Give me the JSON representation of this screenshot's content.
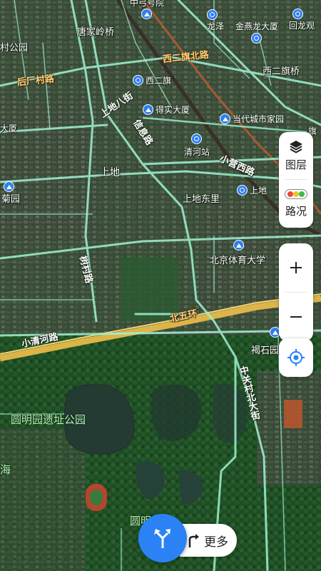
{
  "map": {
    "roads": {
      "xi_er_qi_north": "西二旗北路",
      "hou_chang_cun": "后厂村路",
      "shangdi_8th": "上地八街",
      "xinxi": "信息路",
      "xiaoying_west": "小营西路",
      "shulin": "树村路",
      "north_5th_ring": "北五环",
      "xiao_qing_he": "小清河路",
      "zhongguancun_north": "中关村北大街"
    },
    "places": {
      "tangjialing": "唐家岭桥",
      "xi_er_qi_bridge": "西二旗桥",
      "shangdi": "上地",
      "shangdi_east": "上地东里",
      "cun_park": "村公园",
      "da_po": "大厦",
      "ju_yuan": "菊园",
      "yuanmingyuan": "圆明园遗址公园",
      "yuanming_bottom": "圆明",
      "haidian_edge": "海",
      "zhong_hao_yuan": "中弓号院",
      "qi_small": "旗"
    },
    "pois": {
      "longze": "龙泽",
      "jinyanlong": "金燕龙大厦",
      "huilongguan": "回龙观",
      "xi_er_qi": "西二旗",
      "deshi": "得实大厦",
      "dangdai": "当代城市家园",
      "qinghe": "清河站",
      "shangdi_station": "上地",
      "bsu": "北京体育大学",
      "heshiqiao": "褐石园"
    }
  },
  "controls": {
    "layers": {
      "label": "图层",
      "icon": "layers-icon"
    },
    "traffic": {
      "label": "路况",
      "icon": "traffic-light-icon"
    },
    "zoom_in": {
      "icon": "plus-icon"
    },
    "zoom_out": {
      "icon": "minus-icon"
    },
    "locate": {
      "icon": "locate-icon"
    },
    "navigate": {
      "icon": "route-arrow-icon"
    },
    "more": {
      "label": "更多",
      "icon": "turn-arrow-icon"
    }
  },
  "colors": {
    "accent": "#2a82f5",
    "highway": "#e6b94a",
    "road": "#9ff3d4",
    "traffic_red": "#e84a3a",
    "traffic_yellow": "#f0c22a",
    "traffic_green": "#3dbb4a"
  }
}
